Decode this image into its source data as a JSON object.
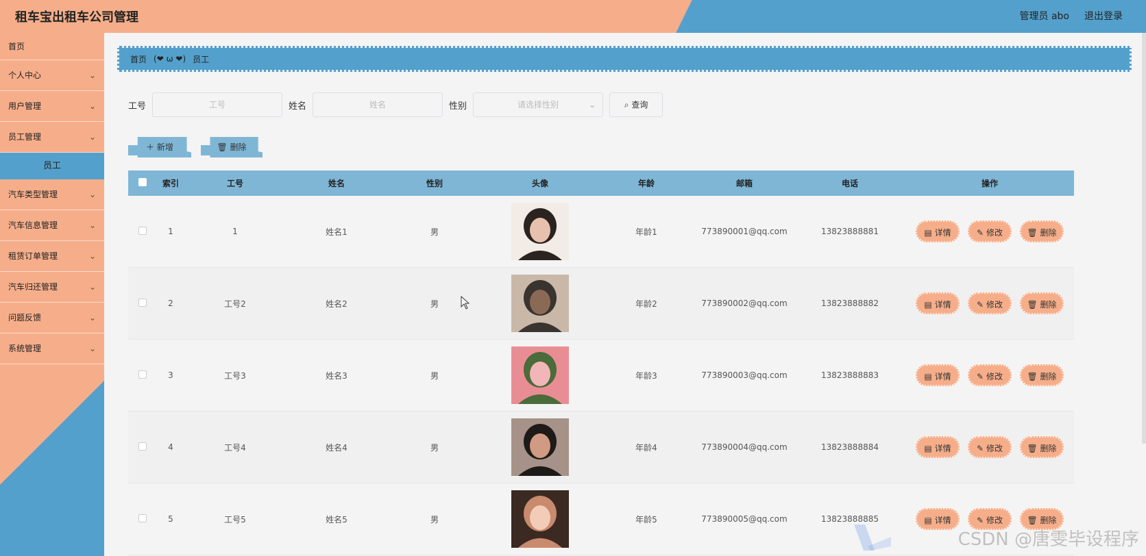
{
  "header": {
    "title": "租车宝出租车公司管理",
    "admin": "管理员 abo",
    "logout": "退出登录"
  },
  "sidebar": {
    "items": [
      {
        "label": "首页"
      },
      {
        "label": "个人中心"
      },
      {
        "label": "用户管理"
      },
      {
        "label": "员工管理"
      },
      {
        "label": "汽车类型管理"
      },
      {
        "label": "汽车信息管理"
      },
      {
        "label": "租赁订单管理"
      },
      {
        "label": "汽车归还管理"
      },
      {
        "label": "问题反馈"
      },
      {
        "label": "系统管理"
      }
    ],
    "sub_active": "员工"
  },
  "breadcrumb": {
    "home": "首页",
    "separator": "(❤ ω ❤)",
    "current": "员工"
  },
  "search": {
    "label_id": "工号",
    "placeholder_id": "工号",
    "label_name": "姓名",
    "placeholder_name": "姓名",
    "label_gender": "性别",
    "placeholder_gender": "请选择性别",
    "query_label": "查询"
  },
  "actions": {
    "add": "新增",
    "delete": "删除"
  },
  "table": {
    "headers": [
      "索引",
      "工号",
      "姓名",
      "性别",
      "头像",
      "年龄",
      "邮箱",
      "电话",
      "操作"
    ],
    "ops": [
      "详情",
      "修改",
      "删除"
    ],
    "rows": [
      {
        "index": "1",
        "id": "1",
        "name": "姓名1",
        "gender": "男",
        "age": "年龄1",
        "email": "773890001@qq.com",
        "phone": "13823888881"
      },
      {
        "index": "2",
        "id": "工号2",
        "name": "姓名2",
        "gender": "男",
        "age": "年龄2",
        "email": "773890002@qq.com",
        "phone": "13823888882"
      },
      {
        "index": "3",
        "id": "工号3",
        "name": "姓名3",
        "gender": "男",
        "age": "年龄3",
        "email": "773890003@qq.com",
        "phone": "13823888883"
      },
      {
        "index": "4",
        "id": "工号4",
        "name": "姓名4",
        "gender": "男",
        "age": "年龄4",
        "email": "773890004@qq.com",
        "phone": "13823888884"
      },
      {
        "index": "5",
        "id": "工号5",
        "name": "姓名5",
        "gender": "男",
        "age": "年龄5",
        "email": "773890005@qq.com",
        "phone": "13823888885"
      }
    ]
  },
  "watermark": "CSDN @唐雯毕设程序",
  "colors": {
    "peach": "#f6ae8a",
    "blue": "#54a0cc",
    "table_head": "#7fb6d6"
  }
}
